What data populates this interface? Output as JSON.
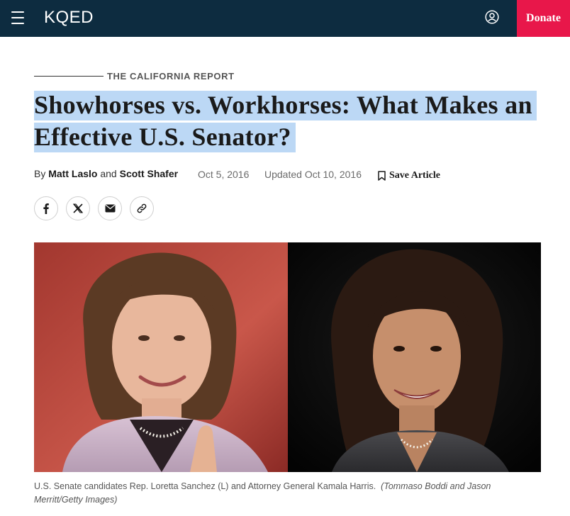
{
  "header": {
    "logo": "KQED",
    "donate_label": "Donate",
    "menu_icon": "hamburger-menu-icon",
    "user_icon": "user-account-icon",
    "bg_color": "#0d2c40",
    "donate_color": "#e8174a"
  },
  "article": {
    "kicker": "THE CALIFORNIA REPORT",
    "title": "Showhorses vs. Workhorses: What Makes an Effective U.S. Senator?",
    "byline": {
      "prefix": "By",
      "author1": "Matt Laslo",
      "conjunction": "and",
      "author2": "Scott Shafer"
    },
    "date": "Oct 5, 2016",
    "updated": "Updated Oct 10, 2016",
    "save_label": "Save Article",
    "share_icons": [
      "facebook-icon",
      "x-twitter-icon",
      "email-icon",
      "copy-link-icon"
    ],
    "image": {
      "left_subject": "Rep. Loretta Sanchez",
      "right_subject": "Attorney General Kamala Harris"
    },
    "caption": "U.S. Senate candidates Rep. Loretta Sanchez (L) and Attorney General Kamala Harris.",
    "credit": "(Tommaso Boddi and Jason Merritt/Getty Images)",
    "highlight_color": "#bcd8f5"
  }
}
